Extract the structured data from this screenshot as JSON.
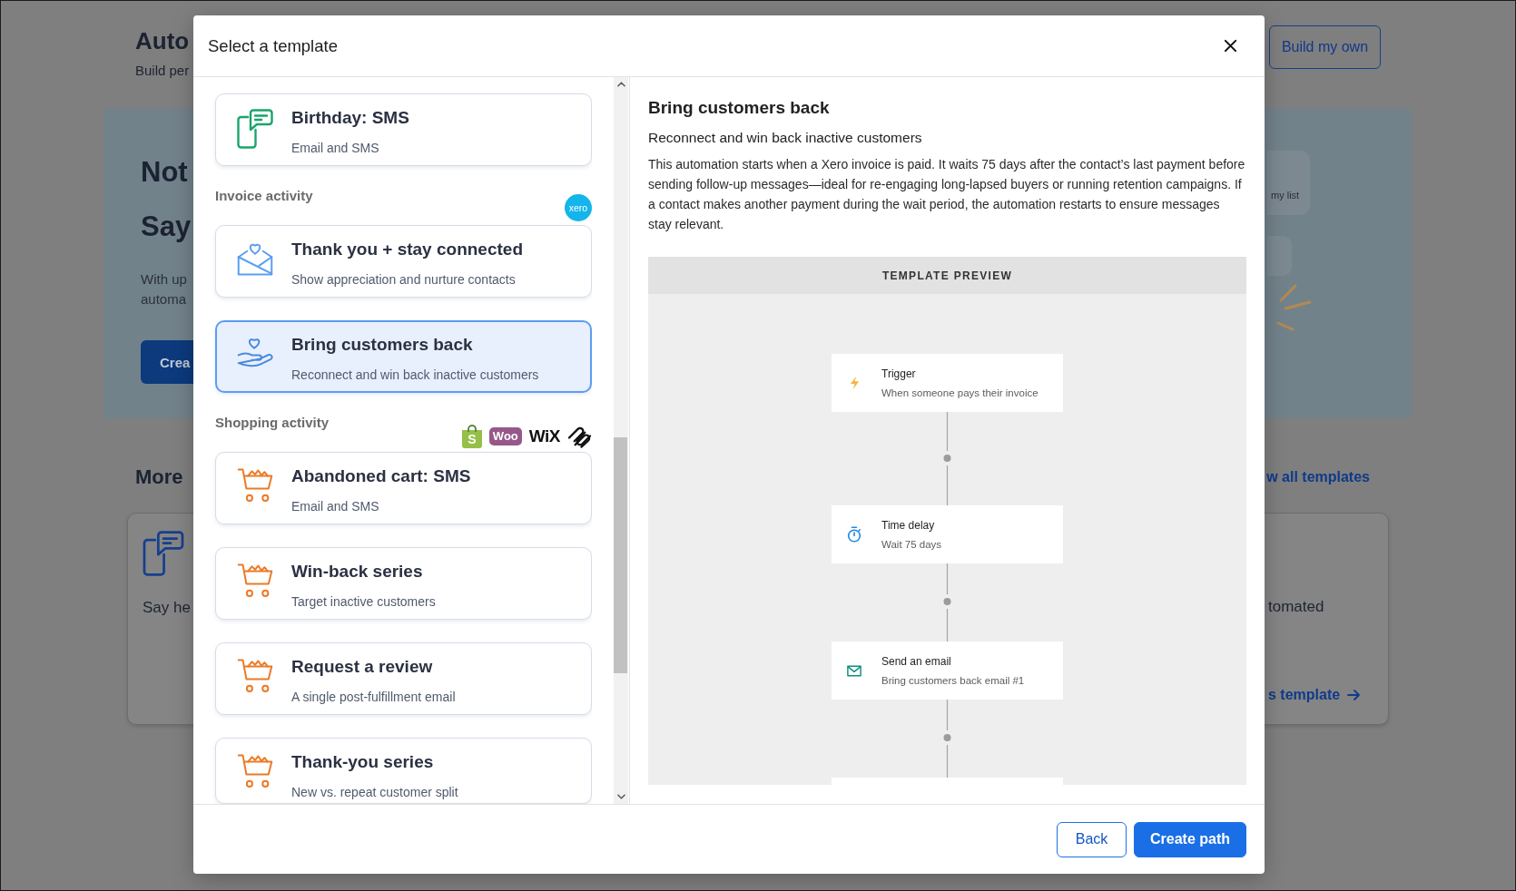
{
  "page": {
    "title": "Auto",
    "subtitle": "Build per",
    "action": "Build my own",
    "hero": {
      "heading": [
        "Not",
        "Say"
      ],
      "lines": [
        "With up",
        "automa"
      ],
      "button": "Crea",
      "side_card": "my list"
    },
    "more": {
      "heading": "More",
      "link": "w all templates",
      "left_card": {
        "kind": "phone-chat",
        "title": "Say he"
      },
      "right_card": {
        "title": "tomated",
        "link": "s template"
      }
    }
  },
  "modal": {
    "title": "Select a template",
    "sections": [
      {
        "cards": [
          {
            "kind": "phone-chat",
            "title": "Birthday: SMS",
            "subtitle": "Email and SMS",
            "selected": false
          }
        ]
      },
      {
        "label": "Invoice activity",
        "logos": [
          {
            "kind": "circle",
            "text": "xero"
          }
        ],
        "cards": [
          {
            "kind": "envelope-heart",
            "title": "Thank you + stay connected",
            "subtitle": "Show appreciation and nurture contacts",
            "selected": false
          },
          {
            "kind": "hand-heart",
            "title": "Bring customers back",
            "subtitle": "Reconnect and win back inactive customers",
            "selected": true
          }
        ]
      },
      {
        "label": "Shopping activity",
        "logos": [
          {
            "kind": "bag",
            "text": "S"
          },
          {
            "kind": "bubble",
            "text": "Woo"
          },
          {
            "kind": "wordmark",
            "text": "WiX"
          },
          {
            "kind": "loops"
          }
        ],
        "cards": [
          {
            "kind": "cart",
            "title": "Abandoned cart: SMS",
            "subtitle": "Email and SMS",
            "selected": false
          },
          {
            "kind": "cart",
            "title": "Win-back series",
            "subtitle": "Target inactive customers",
            "selected": false
          },
          {
            "kind": "cart",
            "title": "Request a review",
            "subtitle": "A single post-fulfillment email",
            "selected": false
          },
          {
            "kind": "cart",
            "title": "Thank-you series",
            "subtitle": "New vs. repeat customer split",
            "selected": false
          }
        ]
      }
    ],
    "detail": {
      "title": "Bring customers back",
      "subtitle": "Reconnect and win back inactive customers",
      "description": "This automation starts when a Xero invoice is paid. It waits 75 days after the contact’s last payment before sending follow-up messages—ideal for re-engaging long-lapsed buyers or running retention campaigns. If a contact makes another payment during the wait period, the automation restarts to ensure messages stay relevant.",
      "preview": {
        "header": "TEMPLATE PREVIEW",
        "nodes": [
          {
            "kind": "trigger",
            "title": "Trigger",
            "subtitle": "When someone pays their invoice"
          },
          {
            "kind": "delay",
            "title": "Time delay",
            "subtitle": "Wait 75 days"
          },
          {
            "kind": "email",
            "title": "Send an email",
            "subtitle": "Bring customers back email #1"
          },
          {
            "kind": "partial"
          }
        ]
      }
    },
    "buttons": [
      {
        "label": "Back",
        "kind": "secondary"
      },
      {
        "label": "Create path",
        "kind": "primary"
      }
    ]
  }
}
